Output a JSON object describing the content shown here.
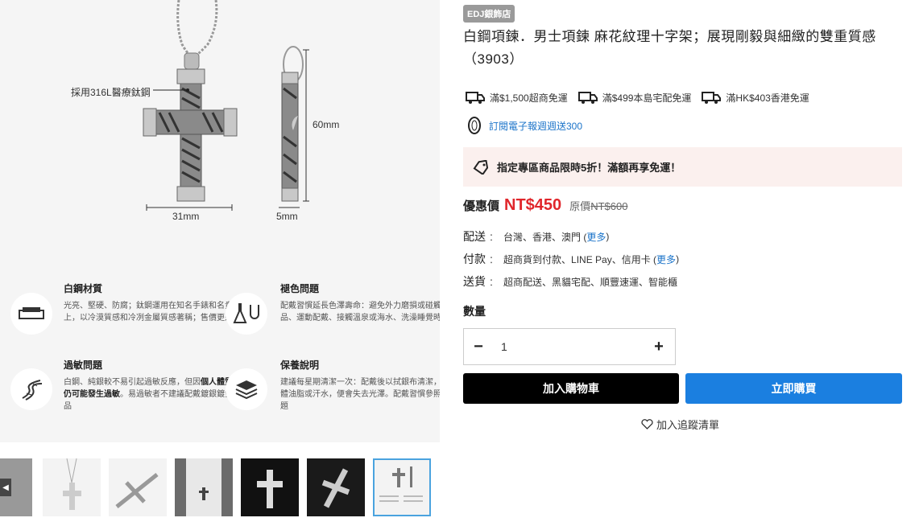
{
  "gallery": {
    "callout": "採用316L醫療鈦鋼",
    "dim_height": "60mm",
    "dim_width1": "31mm",
    "dim_width2": "5mm",
    "features": [
      {
        "title": "白鋼材質",
        "text": "光亮、堅硬、防腐；鈦鋼運用在知名手錶和名貴鋼筆上，以冷漠質感和冷冽金屬質感著稱；售價更是親民",
        "icon": "steel-bar-icon"
      },
      {
        "title": "褪色問題",
        "text": "配戴習慣延長色澤壽命：避免外力磨損或碰觸化學品、運動配戴、接觸溫泉或海水、洗澡睡覺時",
        "icon": "flask-icon"
      },
      {
        "title": "過敏問題",
        "text_a": "白鋼、純銀較不易引起過敏反應，但因",
        "text_b": "個人體質差異仍可能發生過敏",
        "text_c": "。易過敏者不建議配戴鍍銀鍍金鋼飾品",
        "icon": "dna-icon"
      },
      {
        "title": "保養說明",
        "text": "建議每星期清潔一次：配戴後以拭銀布清潔，沾上人體油脂或汗水，便會失去光澤。配戴習慣參照褪色問題",
        "icon": "layers-icon"
      }
    ]
  },
  "store_badge": "EDJ銀飾店",
  "title": "白鋼項鍊．男士項鍊 麻花紋理十字架；展現剛毅與細緻的雙重質感（3903）",
  "shipping": [
    {
      "text": "滿$1,500超商免運",
      "icon": "truck-icon"
    },
    {
      "text": "滿$499本島宅配免運",
      "icon": "truck-icon"
    },
    {
      "text": "滿HK$403香港免運",
      "icon": "truck-icon"
    }
  ],
  "newsletter": "訂閱電子報週週送300",
  "promo": "指定專區商品限時5折！滿額再享免運！",
  "price": {
    "label": "優惠價",
    "value": "NT$450",
    "orig_label": "原價",
    "orig_value": "NT$600"
  },
  "info": {
    "delivery_key": "配送",
    "delivery_val": "台灣、香港、澳門 (",
    "payment_key": "付款",
    "payment_val": "超商貨到付款、LINE Pay、信用卡 (",
    "ship_key": "送貨",
    "ship_val": "超商配送、黑貓宅配、順豐速運、智能櫃",
    "more": "更多",
    "close_paren": ")",
    "sep": "："
  },
  "quantity": {
    "label": "數量",
    "value": "1",
    "minus": "−",
    "plus": "+"
  },
  "buttons": {
    "cart": "加入購物車",
    "buy": "立即購買"
  },
  "wishlist": "加入追蹤清單",
  "colors": {
    "price_red": "#e0262b",
    "buy_blue": "#1b7fe0",
    "promo_bg": "#fbf0ee",
    "link_blue": "#1a73c9"
  }
}
